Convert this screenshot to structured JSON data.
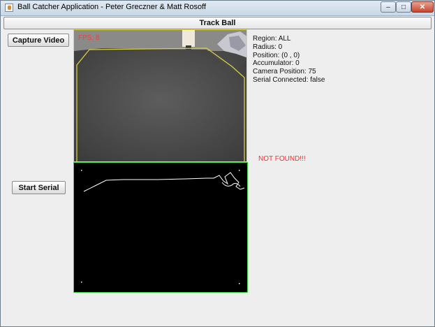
{
  "window": {
    "title": "Ball Catcher Application - Peter Greczner & Matt Rosoff",
    "minimize_label": "–",
    "maximize_label": "□",
    "close_label": "✕"
  },
  "tab": {
    "label": "Track Ball"
  },
  "buttons": {
    "capture_video": "Capture Video",
    "start_serial": "Start Serial"
  },
  "video": {
    "fps": "FPS: 8"
  },
  "info": {
    "region": "Region: ALL",
    "radius": "Radius: 0",
    "position": "Position: (0 , 0)",
    "accumulator": "Accumulator: 0",
    "camera_position": "Camera Position: 75",
    "serial_connected": "Serial Connected: false"
  },
  "status": {
    "not_found": "NOT FOUND!!!"
  }
}
